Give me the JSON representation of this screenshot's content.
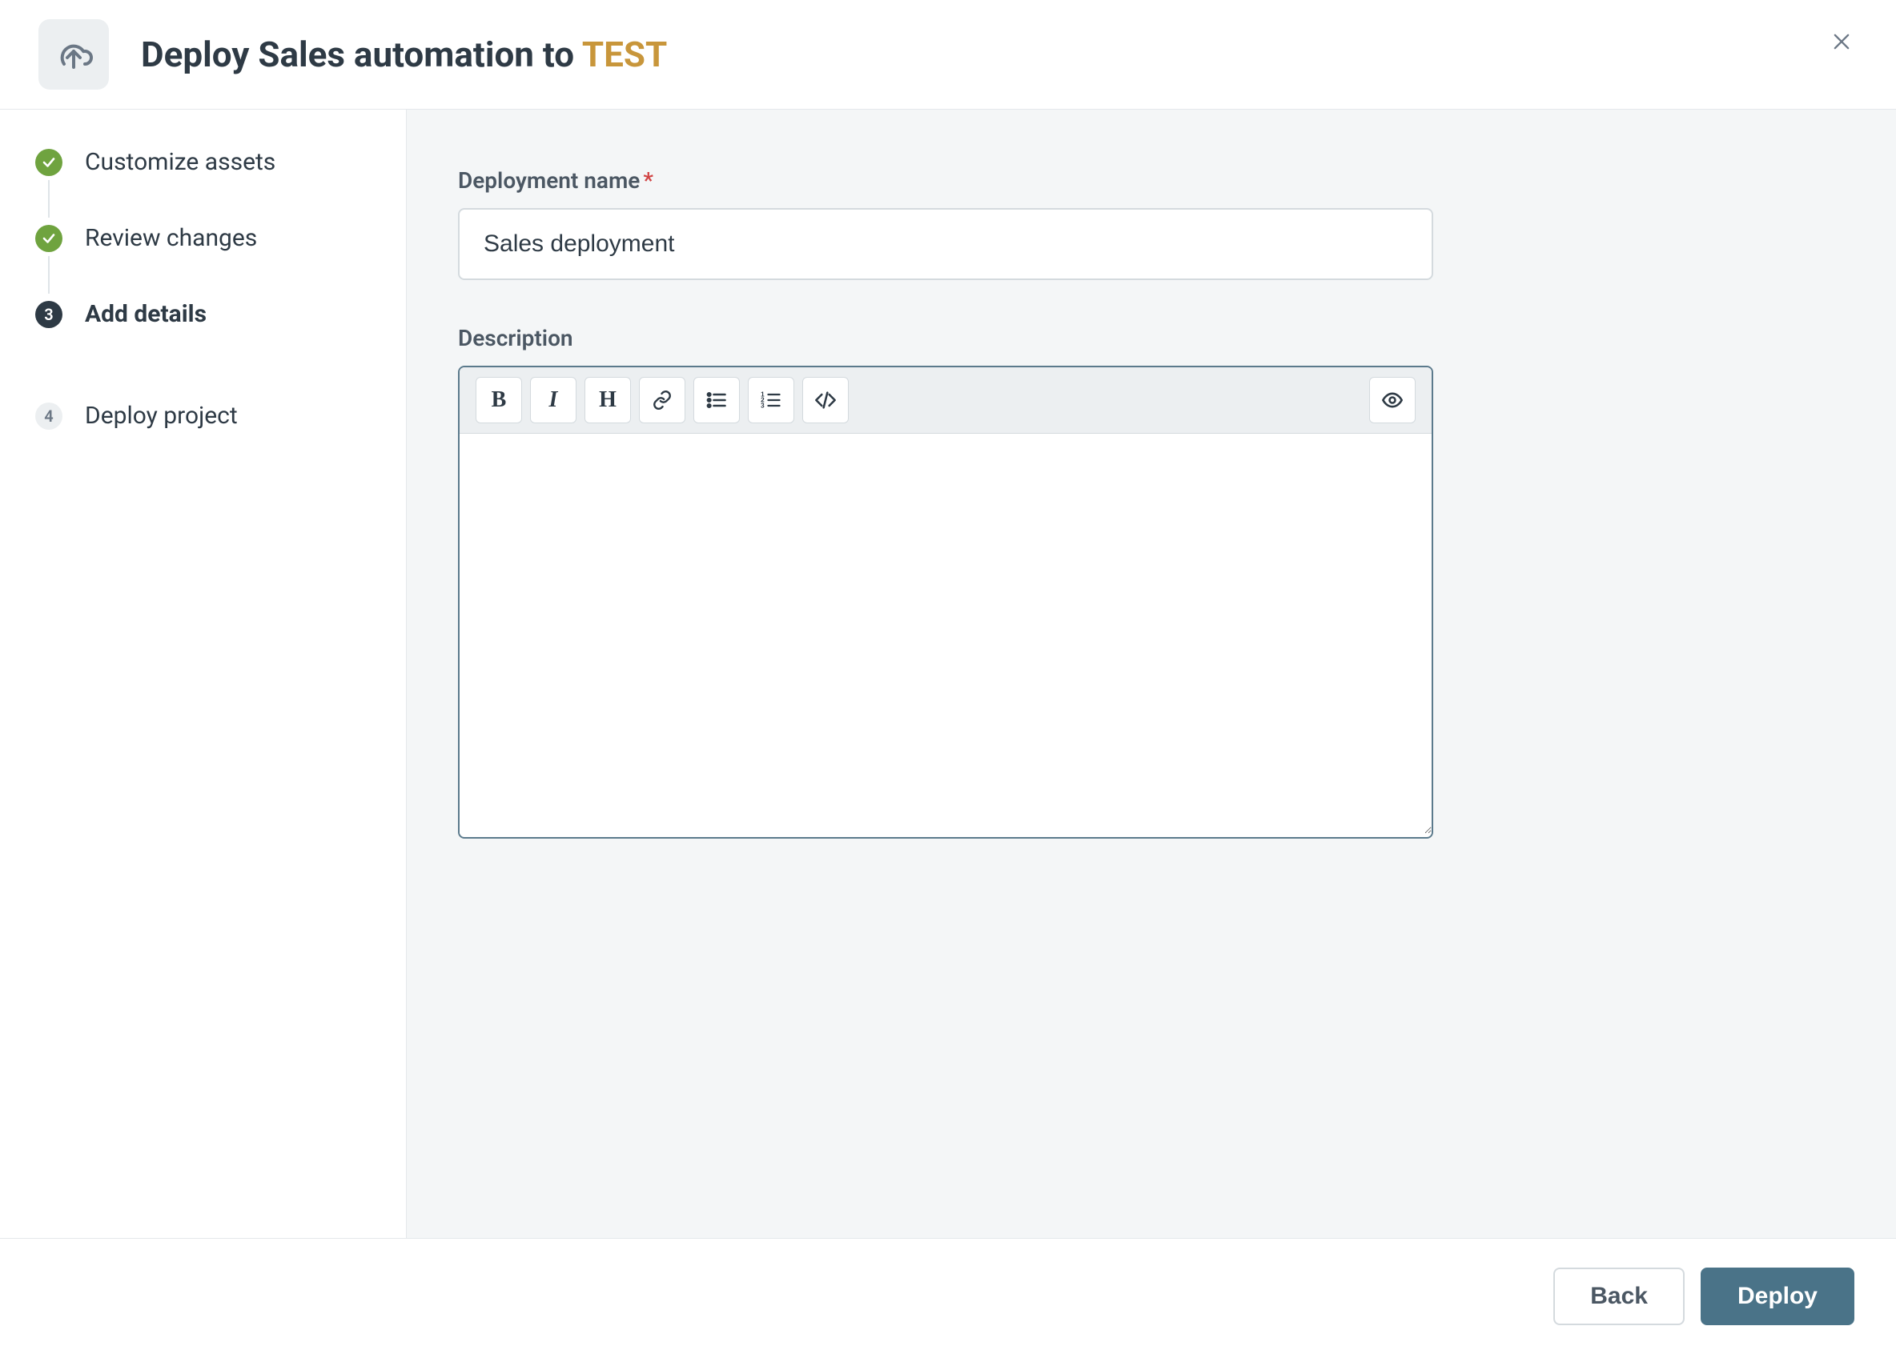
{
  "header": {
    "title_prefix": "Deploy Sales automation to ",
    "environment": "TEST"
  },
  "sidebar": {
    "steps": [
      {
        "label": "Customize assets",
        "state": "done"
      },
      {
        "label": "Review changes",
        "state": "done"
      },
      {
        "label": "Add details",
        "state": "current",
        "number": "3"
      },
      {
        "label": "Deploy project",
        "state": "future",
        "number": "4"
      }
    ]
  },
  "form": {
    "name_label": "Deployment name",
    "name_value": "Sales deployment",
    "description_label": "Description",
    "description_value": ""
  },
  "toolbar": {
    "bold": "B",
    "italic": "I",
    "heading": "H"
  },
  "footer": {
    "back": "Back",
    "deploy": "Deploy"
  }
}
